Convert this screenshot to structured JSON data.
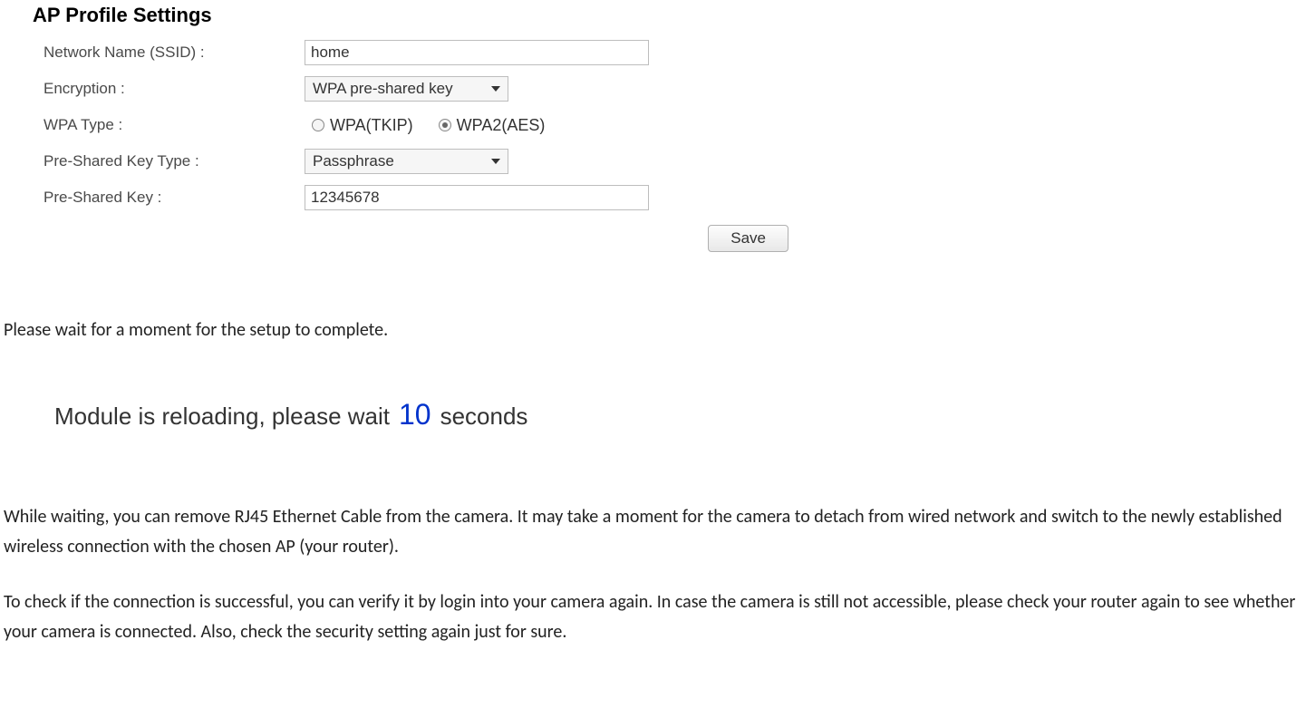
{
  "panel": {
    "title": "AP Profile Settings",
    "rows": {
      "ssid": {
        "label": "Network Name (SSID) :",
        "value": "home"
      },
      "encryption": {
        "label": "Encryption :",
        "value": "WPA pre-shared key"
      },
      "wpaType": {
        "label": "WPA Type :",
        "opt1": "WPA(TKIP)",
        "opt2": "WPA2(AES)"
      },
      "pskType": {
        "label": "Pre-Shared Key Type :",
        "value": "Passphrase"
      },
      "psk": {
        "label": "Pre-Shared Key :",
        "value": "12345678"
      }
    },
    "saveLabel": "Save"
  },
  "instructions": {
    "waitLine": "Please wait for a moment for the setup to complete.",
    "reloadPrefix": "Module is reloading, please wait",
    "reloadSeconds": "10",
    "reloadSuffix": "seconds",
    "para2": "While waiting, you can remove RJ45 Ethernet Cable from the camera. It may take a moment for the camera to detach from wired network and switch to the newly established wireless connection with the chosen AP (your router).",
    "para3": "To check if the connection is successful, you can verify it by login into your camera again. In case the camera is still not accessible, please check your router again to see whether your camera is connected. Also, check the security setting again just for sure."
  }
}
